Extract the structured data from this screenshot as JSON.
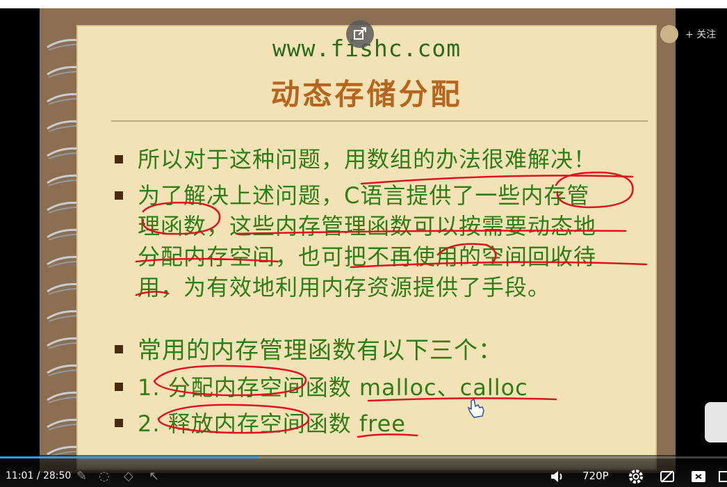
{
  "slide": {
    "site": "www.fishc.com",
    "heading": "动态存储分配",
    "lines": [
      "所以对于这种问题，用数组的办法很难解决！",
      "为了解决上述问题，C语言提供了一些内存管",
      "理函数，这些内存管理函数可以按需要动态地",
      "分配内存空间，也可把不再使用的空间回收待",
      "用，为有效地利用内存资源提供了手段。",
      "常用的内存管理函数有以下三个：",
      "1. 分配内存空间函数 malloc、calloc",
      "2. 释放内存空间函数 free"
    ]
  },
  "overlay": {
    "follow": "+ 关注"
  },
  "player": {
    "current_time": "11:01",
    "separator": "/",
    "total_time": "28:50",
    "progress": 0.356,
    "quality": "720P"
  }
}
